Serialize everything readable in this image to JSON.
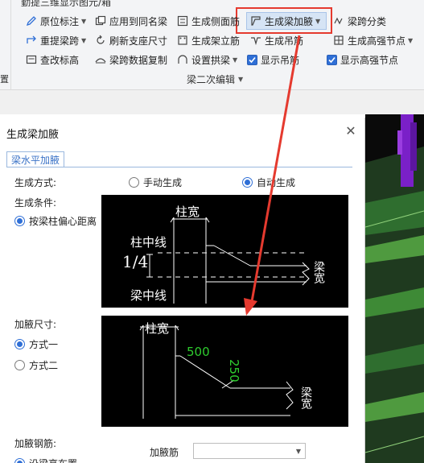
{
  "ribbon": {
    "top_cut_text": "勤提三维显示图元/箱",
    "left_strip_text": "置",
    "row1": {
      "yuanwei": "原位标注",
      "apply_same": "应用到同名梁",
      "side_rebar": "生成侧面筋",
      "haunch": "生成梁加腋",
      "span_class": "梁跨分类"
    },
    "row2": {
      "relift": "重提梁跨",
      "refresh_support": "刷新支座尺寸",
      "beam_stirrup": "生成架立筋",
      "hanger": "生成吊筋",
      "strong_node": "生成高强节点"
    },
    "row3": {
      "check_elev": "查改标高",
      "copy_span": "梁跨数据复制",
      "set_arch": "设置拱梁",
      "show_hanger": "显示吊筋",
      "show_strong": "显示高强节点"
    },
    "group_label": "梁二次编辑"
  },
  "dialog": {
    "title": "生成梁加腋",
    "tab": "梁水平加腋",
    "method_label": "生成方式:",
    "method_manual": "手动生成",
    "method_auto": "自动生成",
    "condition_label": "生成条件:",
    "condition_option": "按梁柱偏心距离",
    "size_label": "加腋尺寸:",
    "size_opt1": "方式一",
    "size_opt2": "方式二",
    "rebar_label": "加腋钢筋:",
    "rebar_option": "沿梁高布置",
    "rebar_field_label": "加腋筋",
    "rebar_field_value": ""
  },
  "diagram1": {
    "col_width": "柱宽",
    "col_center": "柱中线",
    "fraction": "1/4",
    "beam_center": "梁中线",
    "beam_width": "梁宽"
  },
  "diagram2": {
    "col_width": "柱宽",
    "dim_horizontal": "500",
    "dim_vertical": "250",
    "beam_width": "梁宽"
  },
  "colors": {
    "accent": "#2f6fd6",
    "highlight": "#e53a2f",
    "dim_green": "#2ecc2e"
  }
}
